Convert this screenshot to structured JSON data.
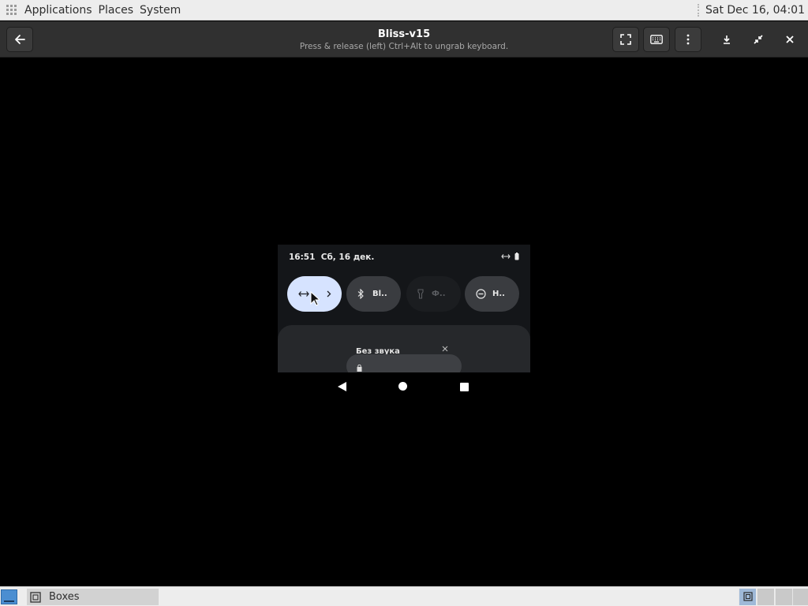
{
  "top_panel": {
    "menus": [
      "Applications",
      "Places",
      "System"
    ],
    "clock": "Sat Dec 16, 04:01"
  },
  "headerbar": {
    "title": "Bliss-v15",
    "subtitle": "Press & release (left) Ctrl+Alt to ungrab keyboard.",
    "icons": [
      "back-arrow-icon",
      "fullscreen-icon",
      "keyboard-icon",
      "menu-dots-icon",
      "download-icon",
      "unfullscreen-icon",
      "close-icon"
    ]
  },
  "android": {
    "time": "16:51",
    "date": "Сб, 16 дек.",
    "tiles": [
      {
        "label": "",
        "state": "on",
        "icon": "data-saver-icon"
      },
      {
        "label": "Bl..",
        "state": "off",
        "icon": "bluetooth-icon"
      },
      {
        "label": "Ф..",
        "state": "disabled",
        "icon": "flashlight-icon"
      },
      {
        "label": "Н..",
        "state": "off",
        "icon": "do-not-disturb-icon"
      }
    ],
    "sheet_title": "Без звука"
  },
  "taskbar": {
    "task_label": "Boxes"
  },
  "colors": {
    "panel_bg": "#ededed",
    "headerbar_bg": "#303030",
    "tile_on": "#d6e3ff",
    "tile_off": "#3a3c40"
  }
}
